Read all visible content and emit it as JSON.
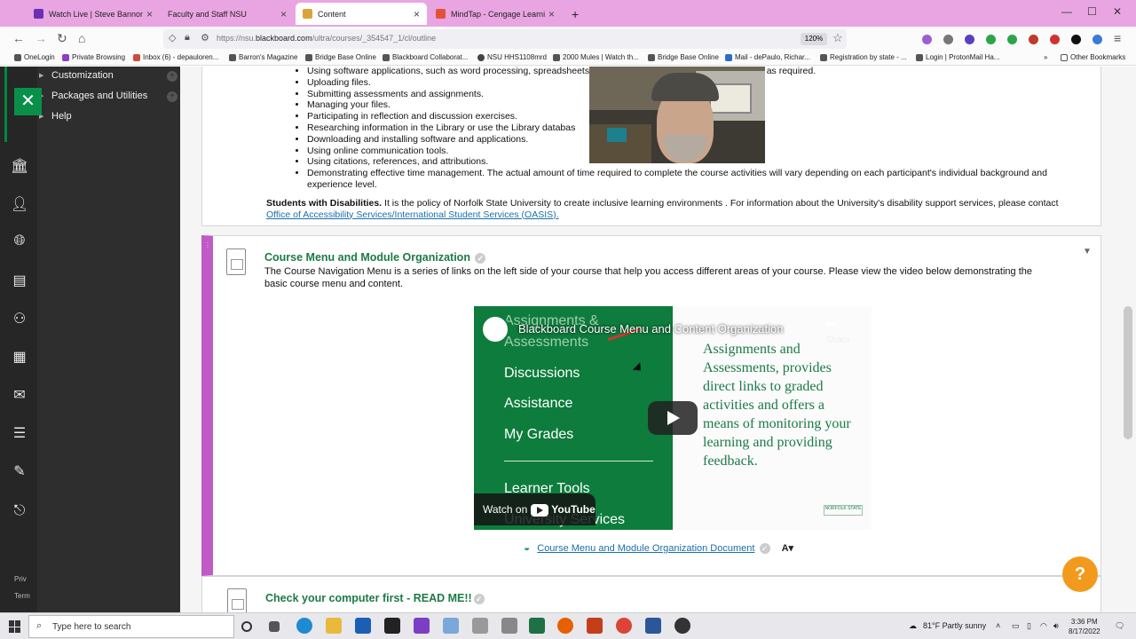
{
  "browser": {
    "tabs": [
      {
        "label": "Watch Live | Steve Bannon War",
        "favicon_color": "#6b2fb3",
        "active": false
      },
      {
        "label": "Faculty and Staff NSU",
        "favicon_color": "#e9a5e2",
        "active": false
      },
      {
        "label": "Content",
        "favicon_color": "#d9a43a",
        "active": true
      },
      {
        "label": "MindTap - Cengage Learning",
        "favicon_color": "#e0533a",
        "active": false
      }
    ],
    "new_tab": "+",
    "url_prefix": "https://nsu.",
    "url_domain": "blackboard.com",
    "url_path": "/ultra/courses/_354547_1/cl/outline",
    "zoom": "120%",
    "bookmarks": [
      "OneLogin",
      "Private Browsing",
      "Inbox (6) - depauloren...",
      "Barron's Magazine",
      "Bridge Base Online",
      "Blackboard Collaborat...",
      "NSU HHS1108mrd",
      "2000 Mules | Watch th...",
      "Bridge Base Online",
      "Mail - dePaulo, Richar...",
      "Registration by state - ...",
      "Login | ProtonMail Ha..."
    ],
    "other_bookmarks": "Other Bookmarks"
  },
  "course_menu": {
    "items": [
      "Customization",
      "Packages and Utilities",
      "Help"
    ],
    "close_label": "✕",
    "footer": [
      "Priv",
      "Term"
    ]
  },
  "section1": {
    "bullets": [
      "Using software applications, such as word processing, spreadsheets, presentation, and email or other software as required.",
      "Uploading files.",
      "Submitting assessments and assignments.",
      "Managing your files.",
      "Participating in reflection and discussion exercises.",
      "Researching information in the Library or use the Library databas",
      "Downloading and installing software and applications.",
      "Using online communication tools.",
      "Using citations, references, and attributions.",
      "Demonstrating effective time management.  The actual amount of time required to complete the course activities will vary depending on each participant's individual background and experience level."
    ],
    "disabilities_label": "Students with Disabilities.",
    "disabilities_text": "  It is the policy of Norfolk State University  to create inclusive learning environments    . For information about the University's    disability support services, please contact  ",
    "disabilities_link": "Office of Accessibility Services/International Student Services (OASIS)."
  },
  "section2": {
    "title": "Course Menu and Module Organization",
    "description": "The Course Navigation Menu is a series of links on the left side of your course that help you access different areas of your course. Please view the video below demonstrating the basic course menu and content.",
    "video": {
      "title": "Blackboard Course Menu and Content Organization",
      "share_label": "Share",
      "left_items": [
        "Assignments &",
        "Assessments",
        "Discussions",
        "Assistance",
        "My Grades",
        "Learner Tools",
        "University Services"
      ],
      "right_text": "Assignments and Assessments, provides direct links to graded activities and offers a means of monitoring your learning and providing feedback.",
      "watch_on": "Watch on",
      "youtube": "YouTube",
      "logo_text": "NORFOLK STATE"
    },
    "document_link": "Course Menu and Module Organization Document",
    "ax_label": "A"
  },
  "section3": {
    "title": "Check your computer first - READ ME!!"
  },
  "help_button": "?",
  "taskbar": {
    "search_placeholder": "Type here to search",
    "weather": "81°F  Partly sunny",
    "time": "3:36 PM",
    "date": "8/17/2022"
  }
}
